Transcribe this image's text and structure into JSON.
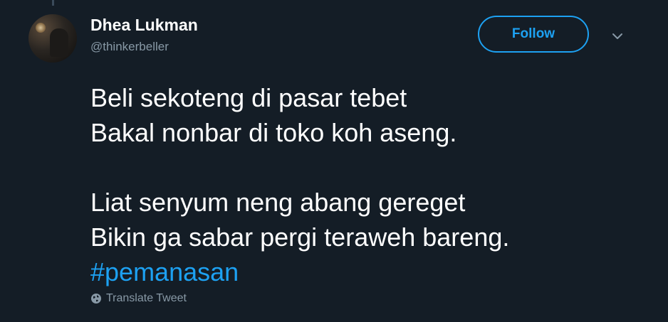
{
  "author": {
    "display_name": "Dhea Lukman",
    "handle": "@thinkerbeller"
  },
  "actions": {
    "follow_label": "Follow"
  },
  "tweet": {
    "lines": [
      "Beli sekoteng di pasar tebet",
      "Bakal nonbar di toko koh aseng.",
      "Liat senyum neng abang gereget",
      "Bikin ga sabar pergi teraweh bareng."
    ],
    "hashtag": "#pemanasan"
  },
  "translate": {
    "label": "Translate Tweet"
  },
  "colors": {
    "background": "#141d26",
    "accent": "#1da1f2",
    "secondary_text": "#8899a6"
  }
}
